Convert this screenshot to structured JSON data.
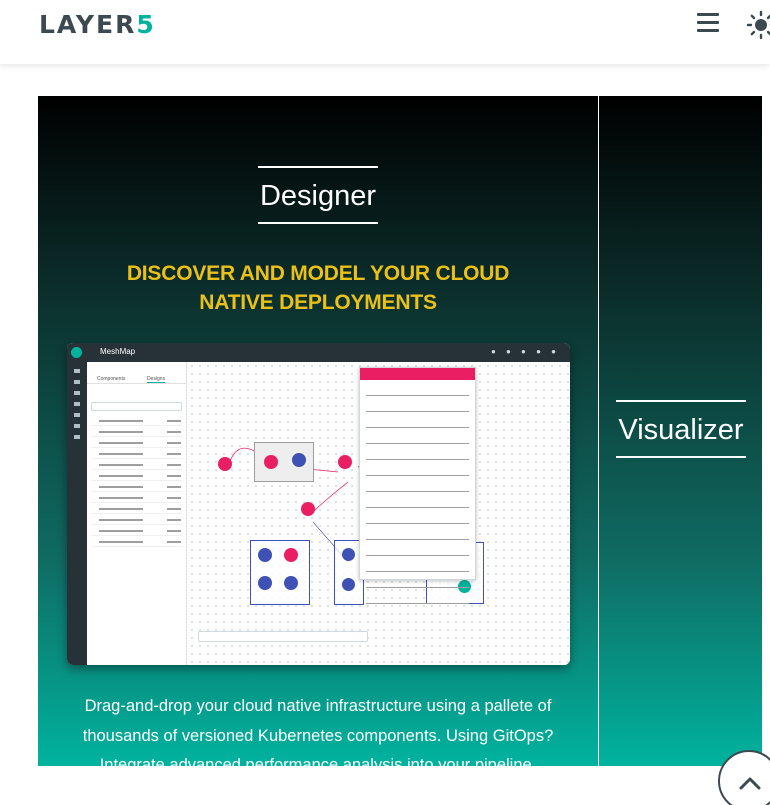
{
  "header": {
    "logo_text_main": "LAYER",
    "logo_text_accent": "5",
    "menu_icon": "hamburger-icon",
    "theme_icon": "sun-icon"
  },
  "designer": {
    "title": "Designer",
    "tagline_line1": "DISCOVER AND MODEL YOUR CLOUD",
    "tagline_line2": "NATIVE DEPLOYMENTS",
    "description_line1": "Drag-and-drop your cloud native infrastructure using a pallete of",
    "description_line2": "thousands of versioned Kubernetes components. Using GitOps?",
    "description_line3": "Integrate advanced performance analysis into your pipeline."
  },
  "visualizer": {
    "title": "Visualizer"
  },
  "screenshot": {
    "app_title": "MeshMap",
    "panel_tab_1": "Components",
    "panel_tab_2": "Designs"
  },
  "colors": {
    "accent": "#00b39f",
    "tagline": "#ebc017",
    "logo": "#3c494f",
    "node_pink": "#e91e63",
    "node_blue": "#3f51b5"
  },
  "scroll_top_icon": "chevron-up-icon"
}
